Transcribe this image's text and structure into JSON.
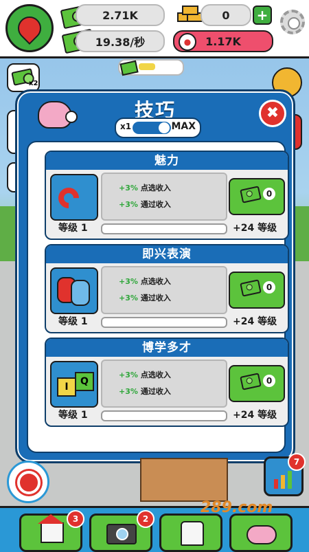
{
  "topbar": {
    "cash": "2.71K",
    "gold": "0",
    "income_rate": "19.38/秒",
    "fans": "1.17K",
    "plus_label": "+"
  },
  "modal": {
    "title": "技巧",
    "toggle_left": "x1",
    "toggle_right": "MAX",
    "close_label": "✖"
  },
  "skills": [
    {
      "name": "魅力",
      "bonus1_pct": "+3%",
      "bonus1_text": "点选收入",
      "bonus2_pct": "+3%",
      "bonus2_text": "通过收入",
      "cost": "0",
      "level": "等级 1",
      "next": "+24 等级",
      "progress": 0.0
    },
    {
      "name": "即兴表演",
      "bonus1_pct": "+3%",
      "bonus1_text": "点选收入",
      "bonus2_pct": "+3%",
      "bonus2_text": "通过收入",
      "cost": "0",
      "level": "等级 1",
      "next": "+24 等级",
      "progress": 0.0
    },
    {
      "name": "博学多才",
      "bonus1_pct": "+3%",
      "bonus1_text": "点选收入",
      "bonus2_pct": "+3%",
      "bonus2_text": "通过收入",
      "cost": "0",
      "level": "等级 1",
      "next": "+24 等级",
      "progress": 0.0
    }
  ],
  "bottom_nav": {
    "home_badge": "3",
    "camera_badge": "2"
  },
  "side": {
    "stats_badge": "7",
    "left_badge": "x2"
  },
  "watermark": "289.com"
}
